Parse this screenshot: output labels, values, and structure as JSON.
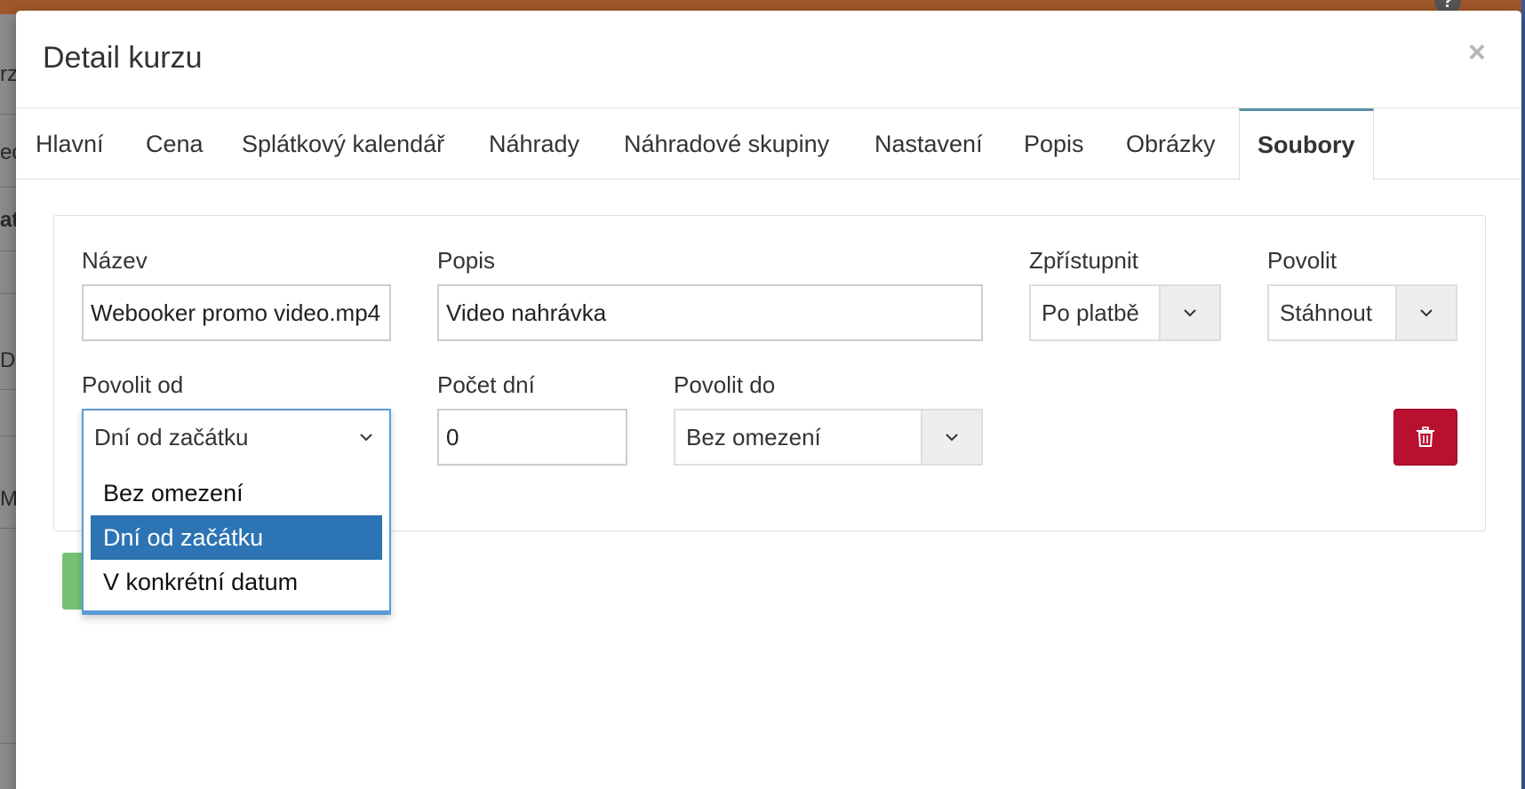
{
  "modal": {
    "title": "Detail kurzu",
    "close": "×"
  },
  "tabs": [
    {
      "label": "Hlavní",
      "active": false
    },
    {
      "label": "Cena",
      "active": false
    },
    {
      "label": "Splátkový kalendář",
      "active": false
    },
    {
      "label": "Náhrady",
      "active": false
    },
    {
      "label": "Náhradové skupiny",
      "active": false
    },
    {
      "label": "Nastavení",
      "active": false
    },
    {
      "label": "Popis",
      "active": false
    },
    {
      "label": "Obrázky",
      "active": false
    },
    {
      "label": "Soubory",
      "active": true
    }
  ],
  "file": {
    "name_label": "Název",
    "name_value": "Webooker promo video.mp4",
    "desc_label": "Popis",
    "desc_value": "Video nahrávka",
    "access_label": "Zpřístupnit",
    "access_value": "Po platbě",
    "allow_label": "Povolit",
    "allow_value": "Stáhnout",
    "allow_from_label": "Povolit od",
    "allow_from_value": "Dní od začátku",
    "allow_from_options": [
      "Bez omezení",
      "Dní od začátku",
      "V konkrétní datum"
    ],
    "days_label": "Počet dní",
    "days_value": "0",
    "allow_to_label": "Povolit do",
    "allow_to_value": "Bez omezení"
  },
  "background": {
    "fragments": [
      "rzy",
      "ec",
      "at",
      "DN",
      "M"
    ]
  },
  "colors": {
    "accent": "#2c74b3",
    "danger": "#b8102e",
    "tab_active_border": "#5b8fa8"
  }
}
